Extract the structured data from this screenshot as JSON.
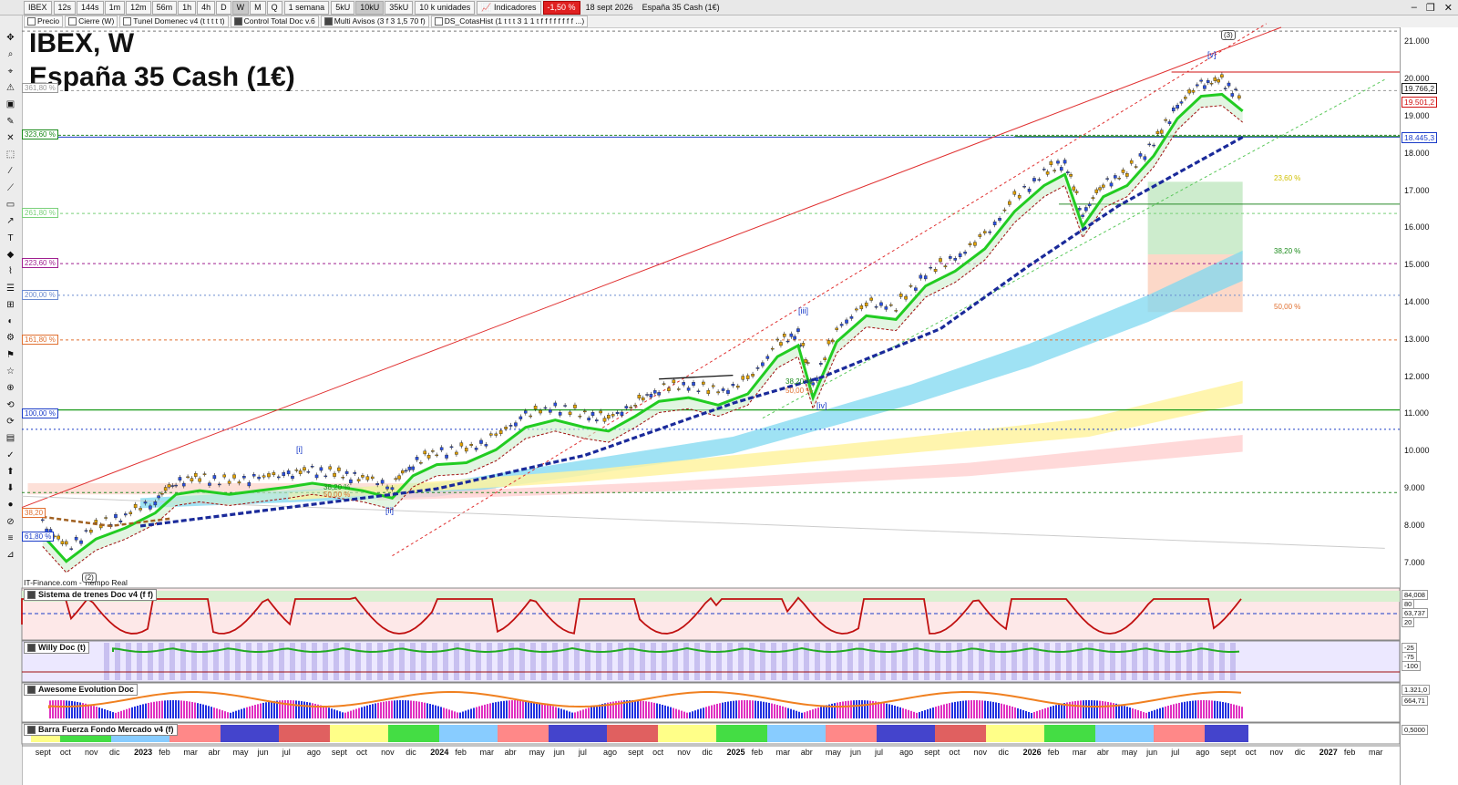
{
  "toolbar": {
    "symbol": "IBEX",
    "intervals": [
      "12s",
      "144s",
      "1m",
      "12m",
      "56m",
      "1h",
      "4h",
      "D",
      "W",
      "M",
      "Q"
    ],
    "selected_interval": "W",
    "period": "1 semana",
    "units": [
      "5kU",
      "10kU",
      "35kU"
    ],
    "selected_unit": "10kU",
    "unit_label": "10 k unidades",
    "indicators_label": "Indicadores",
    "change": "-1,50 %",
    "date": "18 sept 2026",
    "instrument": "España 35 Cash (1€)"
  },
  "indicator_row": [
    {
      "label": "Precio",
      "checked": false
    },
    {
      "label": "Cierre (W)",
      "checked": false
    },
    {
      "label": "Tunel Domenec v4 (t t t t t)",
      "checked": false
    },
    {
      "label": "Control Total Doc v.6",
      "checked": true
    },
    {
      "label": "Multi Avisos (3 f 3 1,5 70 f)",
      "checked": true
    },
    {
      "label": "DS_CotasHist (1 t t t 3 1 1 t f f f f f f f f ...)",
      "checked": false
    }
  ],
  "title_line1": "IBEX, W",
  "title_line2": "España 35 Cash (1€)",
  "credit": "IT-Finance.com - Tiempo Real",
  "y_axis_labels": [
    "21.000",
    "20.000",
    "19.000",
    "18.000",
    "17.000",
    "16.000",
    "15.000",
    "14.000",
    "13.000",
    "12.000",
    "11.000",
    "10.000",
    "9.000",
    "8.000",
    "7.000"
  ],
  "price_tags": [
    {
      "text": "19.766,2",
      "color": "#1a1a1a"
    },
    {
      "text": "19.501,2",
      "color": "#d01010"
    },
    {
      "text": "18.445,3",
      "color": "#1a3cc8"
    }
  ],
  "fib_left": [
    {
      "text": "361,80 %",
      "color": "#999999"
    },
    {
      "text": "323,60 %",
      "color": "#1a8a1a"
    },
    {
      "text": "261,80 %",
      "color": "#7ad07a"
    },
    {
      "text": "223,60 %",
      "color": "#a02090"
    },
    {
      "text": "200,00 %",
      "color": "#6a8ad0"
    },
    {
      "text": "161,80 %",
      "color": "#e07030"
    },
    {
      "text": "100,00 %",
      "color": "#1a3cc8"
    },
    {
      "text": "61,80 %",
      "color": "#1a3cc8"
    },
    {
      "text": "38,20",
      "color": "#e07030"
    }
  ],
  "fib_right": [
    {
      "text": "23,60 %",
      "color": "#d0c000"
    },
    {
      "text": "38,20 %",
      "color": "#1a8a1a"
    },
    {
      "text": "50,00 %",
      "color": "#e07030"
    }
  ],
  "fib_mid": [
    {
      "text": "38,20 %",
      "color": "#1a8a1a"
    },
    {
      "text": "50,00 %",
      "color": "#e07030"
    },
    {
      "text": "38,20 %",
      "color": "#1a8a1a"
    },
    {
      "text": "50,00 %",
      "color": "#e07030"
    }
  ],
  "waves": [
    "(2)",
    "[i]",
    "[ii]",
    "[iii]",
    "[iv]",
    "[v]",
    "(3)"
  ],
  "panels": [
    {
      "name": "Sistema de trenes Doc v4 (f f)",
      "tags": [
        "84,008",
        "80",
        "63,737",
        "20"
      ]
    },
    {
      "name": "Willy Doc (t)",
      "tags": [
        "-25",
        "-75",
        "-100"
      ]
    },
    {
      "name": "Awesome Evolution Doc",
      "tags": [
        "1.321,0",
        "664,71"
      ]
    },
    {
      "name": "Barra Fuerza Fondo Mercado v4 (f)",
      "tags": [
        "0,5000"
      ]
    }
  ],
  "x_axis_labels": [
    {
      "t": "sept",
      "yr": false
    },
    {
      "t": "oct",
      "yr": false
    },
    {
      "t": "nov",
      "yr": false
    },
    {
      "t": "dic",
      "yr": false
    },
    {
      "t": "2023",
      "yr": true
    },
    {
      "t": "feb",
      "yr": false
    },
    {
      "t": "mar",
      "yr": false
    },
    {
      "t": "abr",
      "yr": false
    },
    {
      "t": "may",
      "yr": false
    },
    {
      "t": "jun",
      "yr": false
    },
    {
      "t": "jul",
      "yr": false
    },
    {
      "t": "ago",
      "yr": false
    },
    {
      "t": "sept",
      "yr": false
    },
    {
      "t": "oct",
      "yr": false
    },
    {
      "t": "nov",
      "yr": false
    },
    {
      "t": "dic",
      "yr": false
    },
    {
      "t": "2024",
      "yr": true
    },
    {
      "t": "feb",
      "yr": false
    },
    {
      "t": "mar",
      "yr": false
    },
    {
      "t": "abr",
      "yr": false
    },
    {
      "t": "may",
      "yr": false
    },
    {
      "t": "jun",
      "yr": false
    },
    {
      "t": "jul",
      "yr": false
    },
    {
      "t": "ago",
      "yr": false
    },
    {
      "t": "sept",
      "yr": false
    },
    {
      "t": "oct",
      "yr": false
    },
    {
      "t": "nov",
      "yr": false
    },
    {
      "t": "dic",
      "yr": false
    },
    {
      "t": "2025",
      "yr": true
    },
    {
      "t": "feb",
      "yr": false
    },
    {
      "t": "mar",
      "yr": false
    },
    {
      "t": "abr",
      "yr": false
    },
    {
      "t": "may",
      "yr": false
    },
    {
      "t": "jun",
      "yr": false
    },
    {
      "t": "jul",
      "yr": false
    },
    {
      "t": "ago",
      "yr": false
    },
    {
      "t": "sept",
      "yr": false
    },
    {
      "t": "oct",
      "yr": false
    },
    {
      "t": "nov",
      "yr": false
    },
    {
      "t": "dic",
      "yr": false
    },
    {
      "t": "2026",
      "yr": true
    },
    {
      "t": "feb",
      "yr": false
    },
    {
      "t": "mar",
      "yr": false
    },
    {
      "t": "abr",
      "yr": false
    },
    {
      "t": "may",
      "yr": false
    },
    {
      "t": "jun",
      "yr": false
    },
    {
      "t": "jul",
      "yr": false
    },
    {
      "t": "ago",
      "yr": false
    },
    {
      "t": "sept",
      "yr": false
    },
    {
      "t": "oct",
      "yr": false
    },
    {
      "t": "nov",
      "yr": false
    },
    {
      "t": "dic",
      "yr": false
    },
    {
      "t": "2027",
      "yr": true
    },
    {
      "t": "feb",
      "yr": false
    },
    {
      "t": "mar",
      "yr": false
    }
  ],
  "chart_data": {
    "type": "line",
    "title": "IBEX, W",
    "subtitle": "España 35 Cash (1€)",
    "ylim": [
      6700,
      21400
    ],
    "x_range": [
      "2022-09",
      "2027-03"
    ],
    "last_date": "2026-09-18",
    "series": [
      {
        "name": "",
        "values": [
          [
            2022.67,
            8100
          ],
          [
            2022.75,
            7400
          ],
          [
            2022.85,
            8000
          ],
          [
            2022.95,
            8300
          ],
          [
            2023.05,
            8700
          ],
          [
            2023.12,
            9200
          ],
          [
            2023.2,
            9300
          ],
          [
            2023.3,
            9200
          ],
          [
            2023.4,
            9300
          ],
          [
            2023.5,
            9400
          ],
          [
            2023.58,
            9500
          ],
          [
            2023.67,
            9400
          ],
          [
            2023.75,
            9300
          ],
          [
            2023.85,
            9100
          ],
          [
            2023.92,
            9700
          ],
          [
            2024.0,
            10000
          ],
          [
            2024.1,
            10050
          ],
          [
            2024.2,
            10400
          ],
          [
            2024.3,
            11000
          ],
          [
            2024.4,
            11200
          ],
          [
            2024.5,
            11000
          ],
          [
            2024.58,
            10900
          ],
          [
            2024.67,
            11300
          ],
          [
            2024.75,
            11700
          ],
          [
            2024.85,
            11800
          ],
          [
            2024.95,
            11600
          ],
          [
            2025.05,
            11900
          ],
          [
            2025.15,
            12900
          ],
          [
            2025.22,
            13200
          ],
          [
            2025.27,
            11800
          ],
          [
            2025.35,
            13300
          ],
          [
            2025.45,
            14000
          ],
          [
            2025.55,
            13900
          ],
          [
            2025.65,
            14800
          ],
          [
            2025.75,
            15200
          ],
          [
            2025.85,
            15800
          ],
          [
            2025.95,
            16800
          ],
          [
            2026.05,
            17500
          ],
          [
            2026.12,
            17800
          ],
          [
            2026.18,
            16400
          ],
          [
            2026.25,
            17200
          ],
          [
            2026.33,
            17500
          ],
          [
            2026.42,
            18300
          ],
          [
            2026.5,
            19300
          ],
          [
            2026.58,
            19900
          ],
          [
            2026.65,
            19950
          ],
          [
            2026.72,
            19500
          ]
        ]
      }
    ],
    "horizontal_levels": [
      21300,
      20200,
      19700,
      18450,
      16650,
      15050,
      14200,
      13000,
      11120,
      10600,
      8900
    ],
    "x_ticks_month_labels": true,
    "grid": false
  }
}
